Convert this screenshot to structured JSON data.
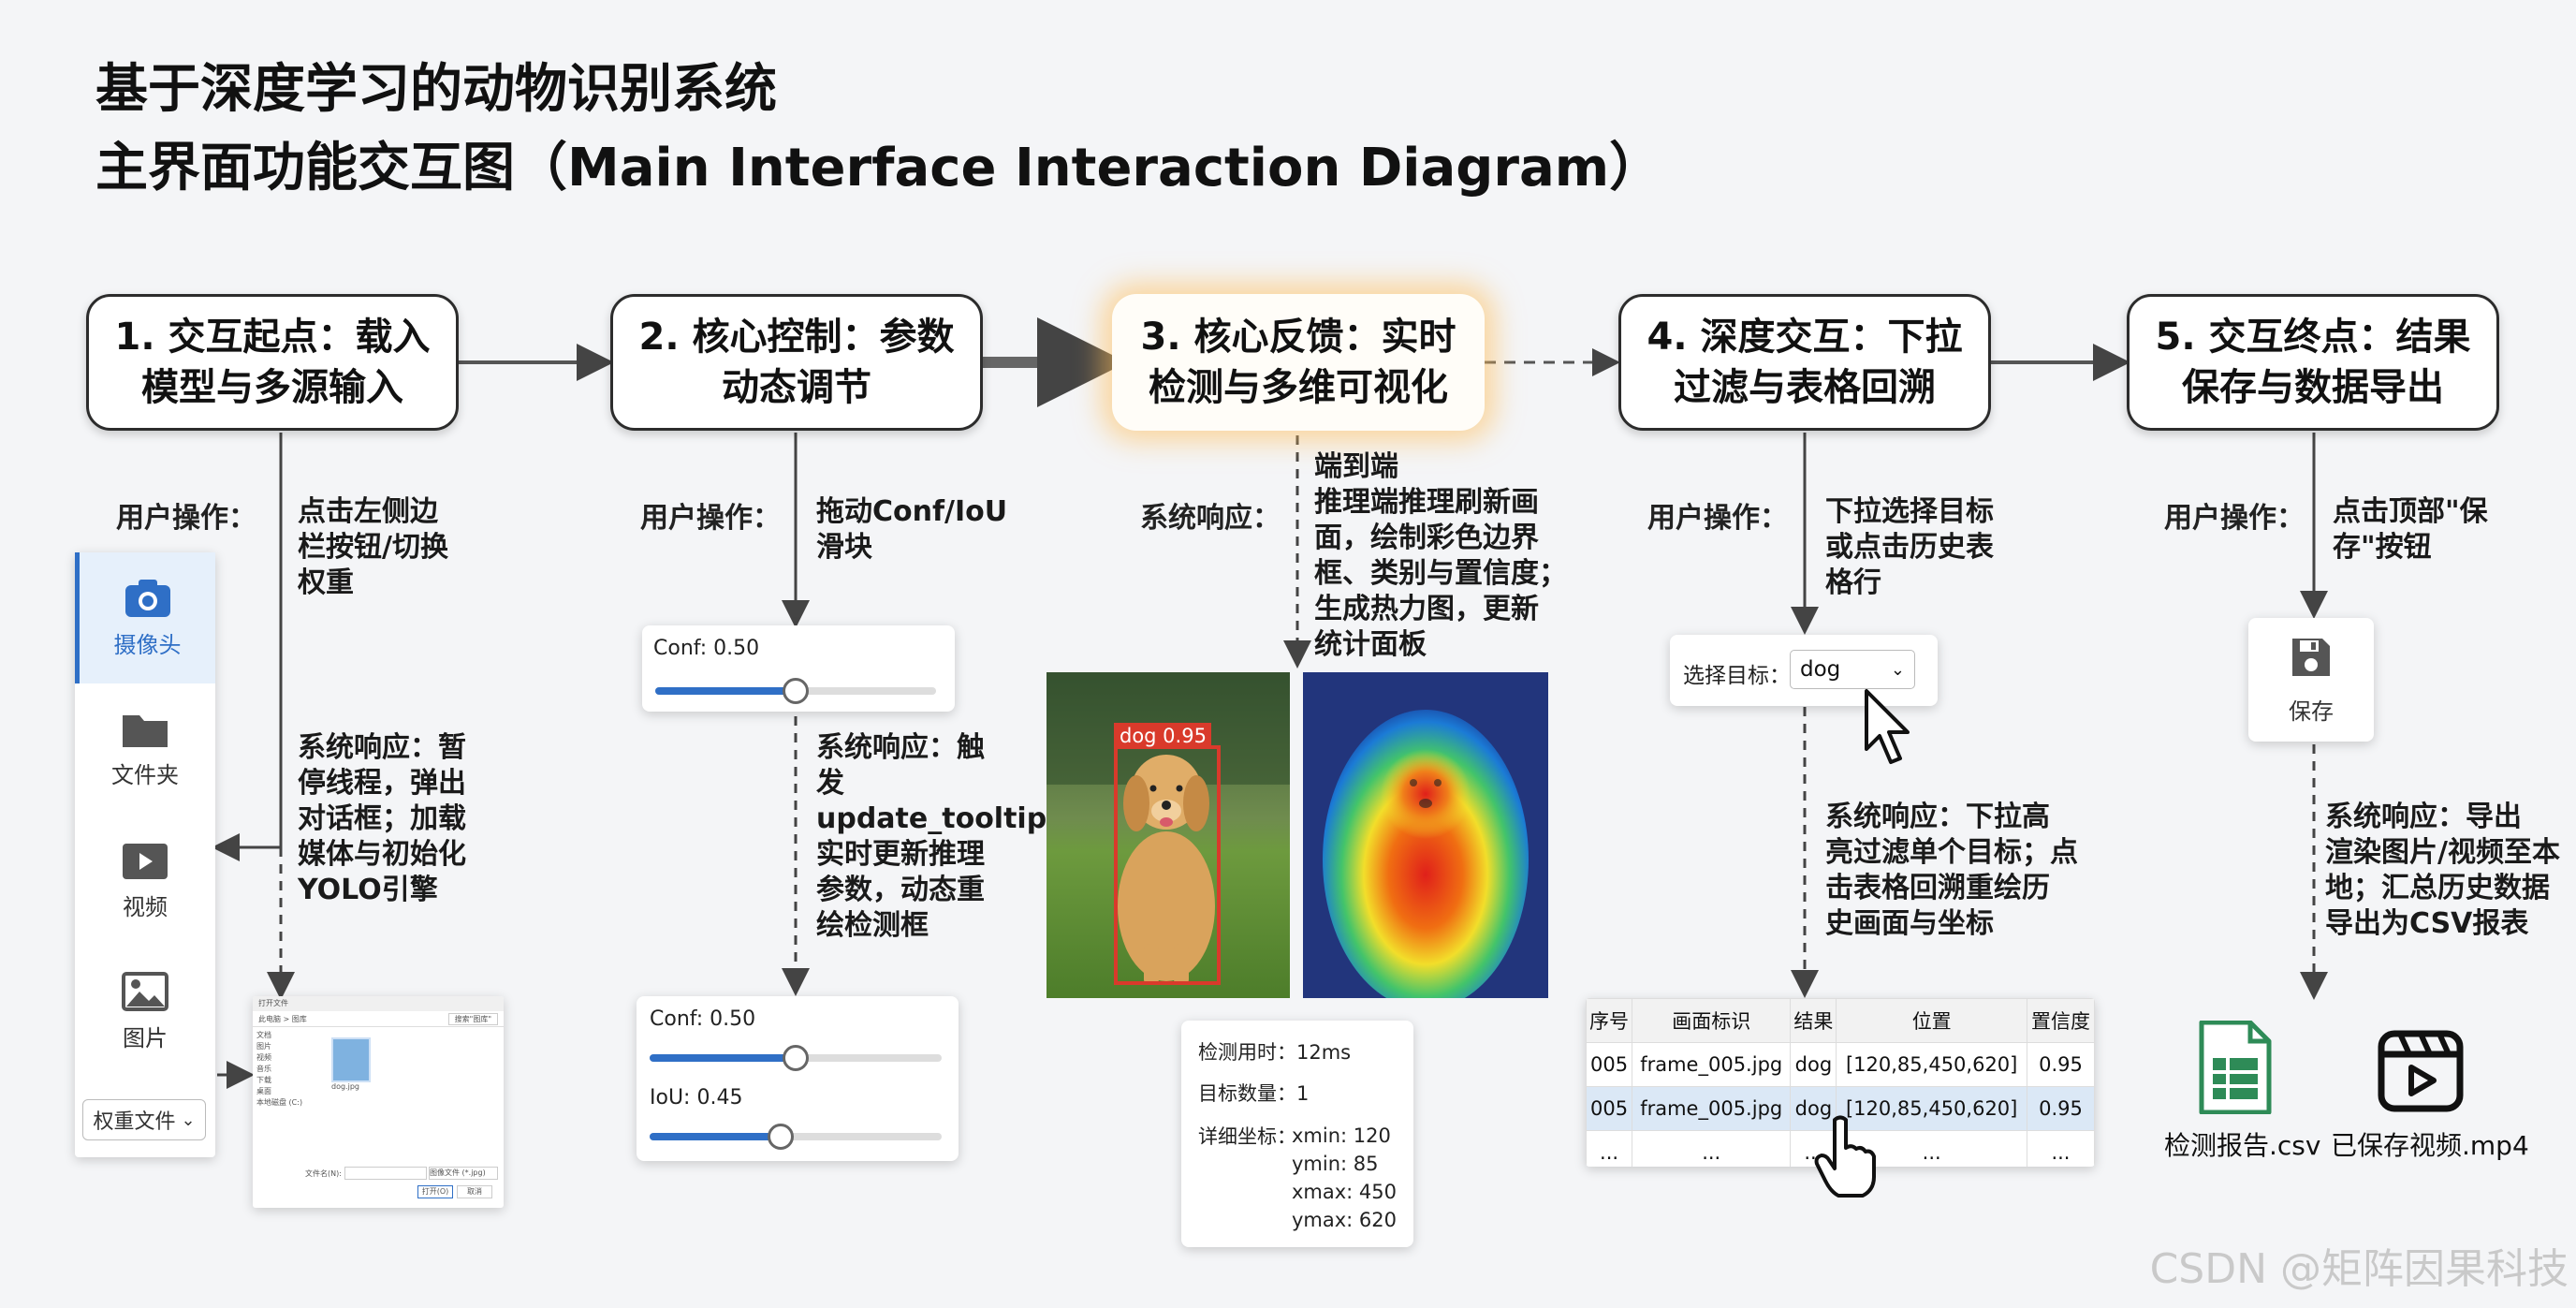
{
  "title": {
    "line1": "基于深度学习的动物识别系统",
    "line2": "主界面功能交互图（Main Interface Interaction Diagram）"
  },
  "steps": [
    {
      "label": "1. 交互起点：载入\n模型与多源输入"
    },
    {
      "label": "2. 核心控制：参数\n动态调节"
    },
    {
      "label": "3. 核心反馈：实时\n检测与多维可视化"
    },
    {
      "label": "4. 深度交互：下拉\n过滤与表格回溯"
    },
    {
      "label": "5. 交互终点：结果\n保存与数据导出"
    }
  ],
  "col1": {
    "user_label": "用户操作：",
    "user_text": "点击左侧边\n栏按钮/切换\n权重",
    "response_text": "系统响应：暂\n停线程，弹出\n对话框；加载\n媒体与初始化\nYOLO引擎",
    "sidebar": {
      "items": [
        {
          "label": "摄像头",
          "icon": "camera-icon"
        },
        {
          "label": "文件夹",
          "icon": "folder-icon"
        },
        {
          "label": "视频",
          "icon": "video-icon"
        },
        {
          "label": "图片",
          "icon": "image-icon"
        }
      ],
      "weight_label": "权重文件"
    },
    "file_dialog": {
      "title": "打开文件",
      "path": "此电脑 > 图库",
      "search": "搜索\"图库\"",
      "file_name": "dog.jpg",
      "filename_label": "文件名(N):",
      "filetype": "图像文件 (*.jpg)",
      "open_label": "打开(O)",
      "cancel_label": "取消",
      "tree": [
        "文档",
        "图片",
        "视频",
        "音乐",
        "下载",
        "桌面",
        "本地磁盘 (C:)"
      ]
    }
  },
  "col2": {
    "user_label": "用户操作：",
    "user_text": "拖动Conf/IoU\n滑块",
    "slider1": {
      "label": "Conf: 0.50",
      "value": 0.5
    },
    "response_text": "系统响应：触\n发\nupdate_tooltip,\n实时更新推理\n参数，动态重\n绘检测框",
    "slider2": {
      "label": "Conf: 0.50",
      "value": 0.5
    },
    "slider3": {
      "label": "IoU: 0.45",
      "value": 0.45
    }
  },
  "col3": {
    "response_label": "系统响应：",
    "response_text": "端到端\n推理端推理刷新画\n面，绘制彩色边界\n框、类别与置信度；\n生成热力图，更新\n统计面板",
    "detection_label": "dog 0.95",
    "stats": {
      "time_label": "检测用时：",
      "time_value": "12ms",
      "count_label": "目标数量：",
      "count_value": "1",
      "coord_label": "详细坐标：",
      "xmin": "xmin: 120",
      "ymin": "ymin: 85",
      "xmax": "xmax: 450",
      "ymax": "ymax: 620"
    }
  },
  "col4": {
    "user_label": "用户操作：",
    "user_text": "下拉选择目标\n或点击历史表\n格行",
    "select_label": "选择目标：",
    "select_value": "dog",
    "response_text": "系统响应：下拉高\n亮过滤单个目标；点\n击表格回溯重绘历\n史画面与坐标",
    "table": {
      "headers": [
        "序号",
        "画面标识",
        "结果",
        "位置",
        "置信度"
      ],
      "rows": [
        [
          "005",
          "frame_005.jpg",
          "dog",
          "[120,85,450,620]",
          "0.95"
        ],
        [
          "005",
          "frame_005.jpg",
          "dog",
          "[120,85,450,620]",
          "0.95"
        ],
        [
          "...",
          "...",
          "...",
          "...",
          "..."
        ]
      ]
    }
  },
  "col5": {
    "user_label": "用户操作：",
    "user_text": "点击顶部\"保\n存\"按钮",
    "save_label": "保存",
    "response_text": "系统响应：导出\n渲染图片/视频至本\n地；汇总历史数据\n导出为CSV报表",
    "files": [
      {
        "label": "检测报告.csv",
        "icon": "spreadsheet-icon"
      },
      {
        "label": "已保存视频.mp4",
        "icon": "video-file-icon"
      }
    ]
  },
  "watermark": "CSDN @矩阵因果科技",
  "colors": {
    "accent": "#2f6fc6",
    "box_red": "#d93a2b",
    "highlight_row": "#dbe8f6"
  }
}
